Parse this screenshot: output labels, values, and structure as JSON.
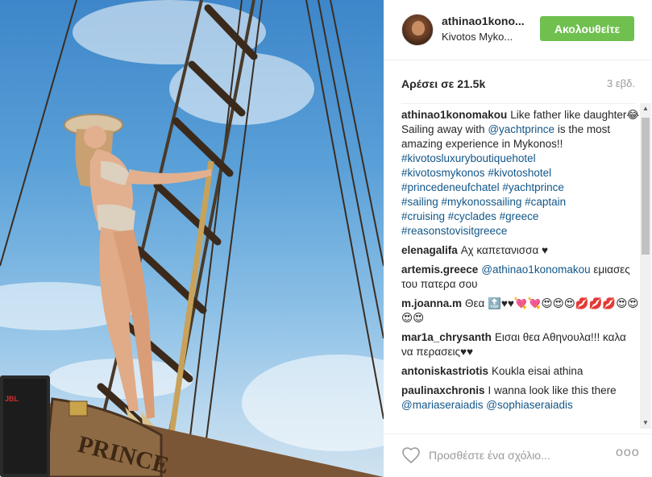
{
  "post": {
    "username": "athinao1kono...",
    "location": "Kivotos Myko...",
    "follow_label": "Ακολουθείτε",
    "likes": "Αρέσει σε 21.5k",
    "time": "3 εβδ."
  },
  "caption": {
    "user": "athinao1konomakou",
    "line1": "Like father like daughter😂",
    "line2a": "Sailing away with ",
    "mention": "@yachtprince",
    "line2b": " is the most amazing experience in Mykonos!!",
    "hashtags": [
      "#kivotosluxuryboutiquehotel",
      "#kivotosmykonos",
      "#kivotoshotel",
      "#princedeneufchatel",
      "#yachtprince",
      "#sailing",
      "#mykonossailing",
      "#captain",
      "#cruising",
      "#cyclades",
      "#greece",
      "#reasonstovisitgreece"
    ]
  },
  "comments": [
    {
      "user": "elenagalifa",
      "text": "Αχ καπετανισσα ♥"
    },
    {
      "user": "artemis.greece",
      "mention": "@athinao1konomakou",
      "text": " εμιασες του πατερα σου"
    },
    {
      "user": "m.joanna.m",
      "text": "Θεα 🔝♥♥💘💘😍😍😍💋💋💋😍😍😍😍"
    },
    {
      "user": "mar1a_chrysanth",
      "text": "Εισαι θεα Αθηνουλα!!! καλα να περασεις♥♥"
    },
    {
      "user": "antoniskastriotis",
      "text": "Koukla eisai athina"
    },
    {
      "user": "paulinaxchronis",
      "text": "I wanna look like this there ",
      "mentions": "@mariaseraiadis @sophiaseraiadis"
    }
  ],
  "footer": {
    "comment_placeholder": "Προσθέστε ένα σχόλιο...",
    "more_label": "ooo"
  },
  "photo": {
    "boat_sign": "PRINCE",
    "speaker_label": "JBL"
  },
  "colors": {
    "follow_button": "#70c050",
    "link": "#125688",
    "muted": "#999999"
  },
  "icons": [
    "heart-icon",
    "more-options-icon",
    "scroll-up-arrow-icon",
    "scroll-down-arrow-icon"
  ]
}
